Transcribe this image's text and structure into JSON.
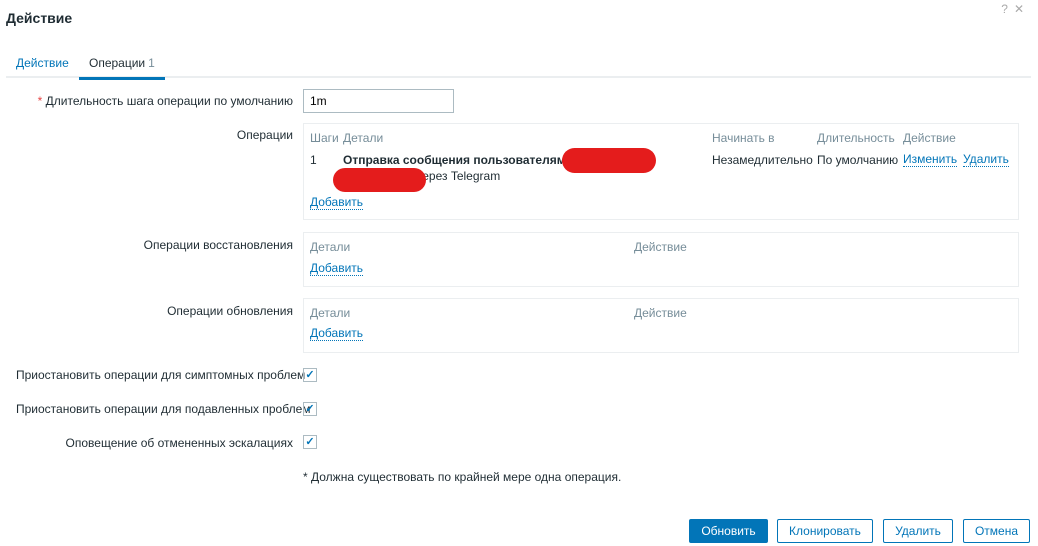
{
  "dialog": {
    "title": "Действие",
    "help_icon": "?",
    "close_icon": "✕"
  },
  "tabs": [
    {
      "label": "Действие"
    },
    {
      "label": "Операции",
      "count": "1"
    }
  ],
  "form": {
    "default_step_label": "Длительность шага операции по умолчанию",
    "required_mark": "*",
    "default_step_value": "1m",
    "operations_label": "Операции",
    "operations": {
      "headers": [
        "Шаги",
        "Детали",
        "Начинать в",
        "Длительность",
        "Действие"
      ],
      "rows": [
        {
          "step": "1",
          "details_line1": "Отправка сообщения пользователям",
          "details_line2": "через Telegram",
          "start_in": "Незамедлительно",
          "duration": "По умолчанию",
          "edit": "Изменить",
          "remove": "Удалить"
        }
      ],
      "add": "Добавить"
    },
    "recovery_label": "Операции восстановления",
    "recovery": {
      "headers": [
        "Детали",
        "Действие"
      ],
      "add": "Добавить"
    },
    "update_label": "Операции обновления",
    "update": {
      "headers": [
        "Детали",
        "Действие"
      ],
      "add": "Добавить"
    },
    "checkboxes": [
      {
        "label": "Приостановить операции для симптомных проблем",
        "checked": true
      },
      {
        "label": "Приостановить операции для подавленных проблем",
        "checked": true
      },
      {
        "label": "Оповещение об отмененных эскалациях",
        "checked": true
      }
    ],
    "note": "* Должна существовать по крайней мере одна операция."
  },
  "buttons": {
    "update": "Обновить",
    "clone": "Клонировать",
    "delete": "Удалить",
    "cancel": "Отмена"
  }
}
